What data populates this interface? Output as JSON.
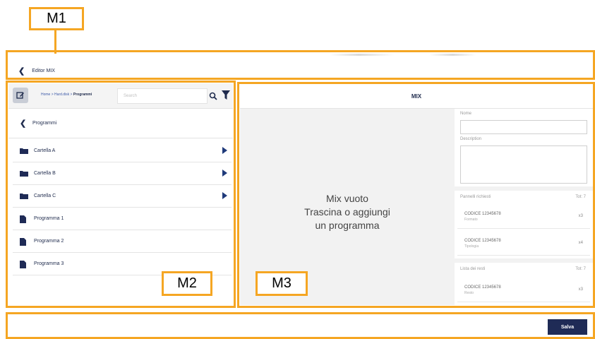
{
  "annotations": {
    "m1": "M1",
    "m2": "M2",
    "m3": "M3"
  },
  "header": {
    "back_label": "Editor MIX"
  },
  "left": {
    "breadcrumb": {
      "home": "Home",
      "sep1": " > ",
      "mid": "Hard.disk",
      "sep2": " > ",
      "current": "Programmi"
    },
    "search_placeholder": "Search",
    "back_label": "Programmi",
    "folders": [
      {
        "label": "Cartella A"
      },
      {
        "label": "Cartella B"
      },
      {
        "label": "Cartella C"
      }
    ],
    "programs": [
      {
        "label": "Programma 1"
      },
      {
        "label": "Programma 2"
      },
      {
        "label": "Programma 3"
      }
    ]
  },
  "right": {
    "title": "MIX",
    "empty_line1": "Mix vuoto",
    "empty_line2": "Trascina o aggiungi",
    "empty_line3": "un programma",
    "form": {
      "name_label": "Nome",
      "description_label": "Description"
    },
    "required_panels": {
      "title": "Pannelli richiesti",
      "total": "Tot: 7",
      "items": [
        {
          "code": "CODICE 12345678",
          "sub": "Formato",
          "qty": "x3"
        },
        {
          "code": "CODICE 12345678",
          "sub": "Tipologia",
          "qty": "x4"
        }
      ]
    },
    "remnants": {
      "title": "Lista dei resti",
      "total": "Tot: 7",
      "items": [
        {
          "code": "CODICE 12345678",
          "sub": "Resto",
          "qty": "x3"
        }
      ]
    }
  },
  "footer": {
    "save_label": "Salva"
  },
  "colors": {
    "annotation": "#f5a623",
    "primary": "#1f2b56",
    "accent_arrow": "#1f3a7a"
  }
}
